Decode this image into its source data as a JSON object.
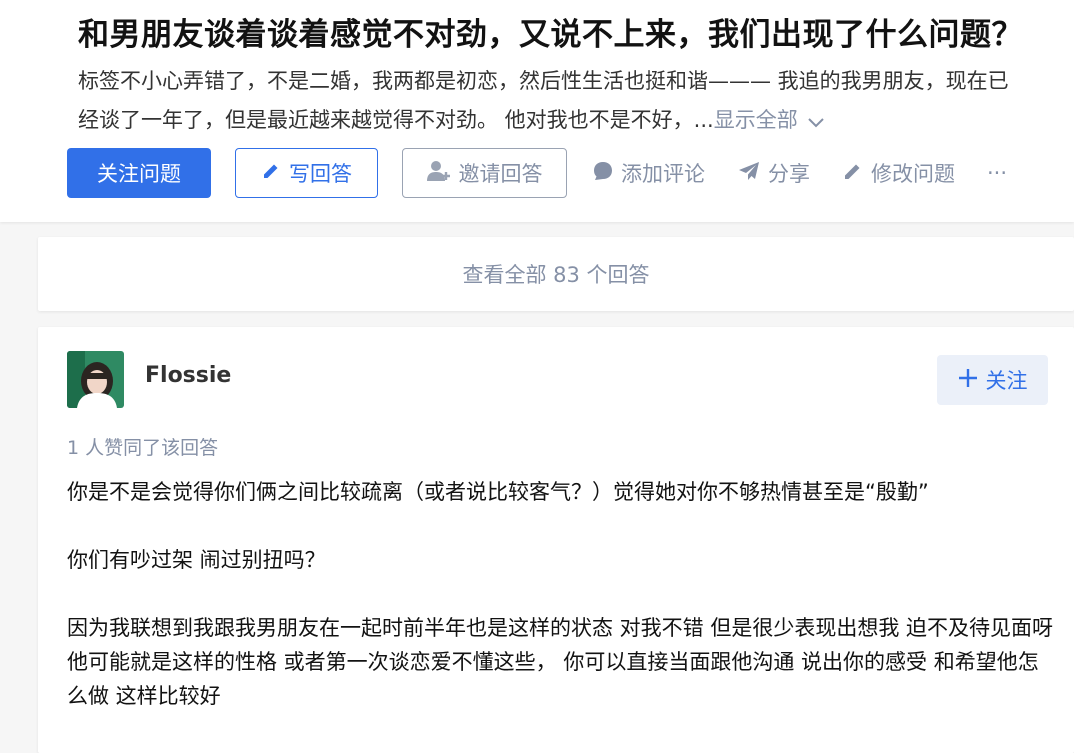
{
  "question": {
    "title": "和男朋友谈着谈着感觉不对劲，又说不上来，我们出现了什么问题？",
    "detail_line1": "标签不小心弄错了，不是二婚，我两都是初恋，然后性生活也挺和谐——— 我追的我男朋友，现在已",
    "detail_line2": "经谈了一年了，但是最近越来越觉得不对劲。 他对我也不是不好，...",
    "show_all_label": "显示全部"
  },
  "actions": {
    "follow_question": "关注问题",
    "write_answer": "写回答",
    "invite_answer": "邀请回答",
    "add_comment": "添加评论",
    "share": "分享",
    "edit_question": "修改问题",
    "more": "···"
  },
  "view_all_answers": "查看全部 83 个回答",
  "answer": {
    "author": "Flossie",
    "follow_label": "关注",
    "vote_info": "1 人赞同了该回答",
    "paragraphs": [
      "你是不是会觉得你们俩之间比较疏离（或者说比较客气？）觉得她对你不够热情甚至是“殷勤”",
      "你们有吵过架 闹过别扭吗？",
      "因为我联想到我跟我男朋友在一起时前半年也是这样的状态 对我不错 但是很少表现出想我 迫不及待见面呀 他可能就是这样的性格 或者第一次谈恋爱不懂这些， 你可以直接当面跟他沟通 说出你的感受 和希望他怎么做 这样比较好"
    ]
  },
  "colors": {
    "primary": "#3170e8",
    "muted": "#8590a6",
    "follow_bg": "#ebf0f9"
  }
}
